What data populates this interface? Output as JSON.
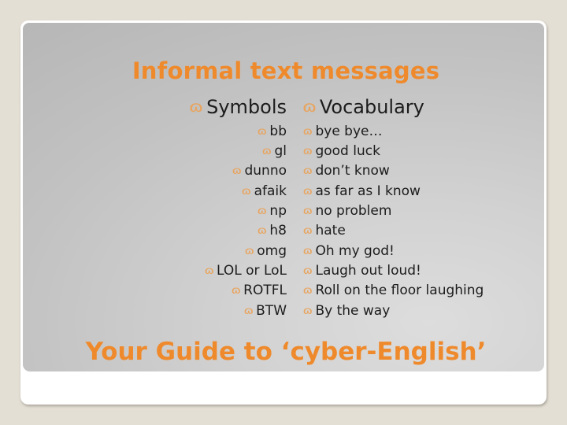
{
  "slide": {
    "title": "Informal text messages",
    "subtitle": "Your Guide to ‘cyber-English’",
    "bullet_glyph": "ɷ",
    "accent_color": "#ef8a2c",
    "bullet_color": "#e8a45e",
    "text_color": "#1c1c1c",
    "canvas_color": "#e4dfd5",
    "columns": [
      {
        "id": "symbols",
        "heading": "Symbols",
        "align": "right",
        "items": [
          "bb",
          "gl",
          "dunno",
          "afaik",
          "np",
          "h8",
          "omg",
          "LOL or LoL",
          "ROTFL",
          "BTW"
        ]
      },
      {
        "id": "vocabulary",
        "heading": "Vocabulary",
        "align": "left",
        "items": [
          "bye bye…",
          "good luck",
          "don’t know",
          "as far as I know",
          "no problem",
          "hate",
          "Oh my god!",
          "Laugh out loud!",
          "Roll on the floor laughing",
          "By the way"
        ]
      }
    ]
  }
}
